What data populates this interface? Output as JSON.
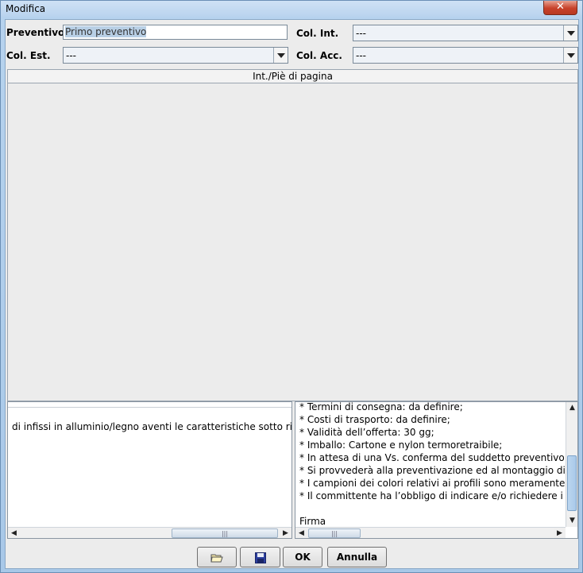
{
  "window": {
    "title": "Modifica",
    "close_glyph": "✕"
  },
  "form": {
    "preventivo_label": "Preventivo",
    "preventivo_value": "Primo preventivo",
    "col_int_label": "Col. Int.",
    "col_int_value": "---",
    "col_est_label": "Col. Est.",
    "col_est_value": "---",
    "col_acc_label": "Col. Acc.",
    "col_acc_value": "---"
  },
  "panel": {
    "header": "Int./Piè di pagina"
  },
  "left_pane": {
    "lines": [
      "di infissi in alluminio/legno aventi le caratteristiche sotto riportate."
    ]
  },
  "right_pane": {
    "lines": [
      "* Termini di consegna: da definire;",
      "* Costi di trasporto: da definire;",
      "* Validità dell’offerta: 30 gg;",
      "* Imballo: Cartone e nylon termoretraibile;",
      "* In attesa di una Vs. conferma del suddetto preventivo alle co",
      "* Si provvederà alla preventivazione ed al montaggio di vetri st",
      "* I campioni dei colori relativi ai profili sono meramente indica",
      "* Il committente ha l’obbligo di indicare e/o richiedere i valori U",
      "",
      "Firma"
    ]
  },
  "buttons": {
    "open_icon": "folder-icon",
    "save_icon": "floppy-disk-icon",
    "ok_label": "OK",
    "cancel_label": "Annulla"
  },
  "colors": {
    "accent": "#b8cfe5",
    "close": "#c7412a"
  }
}
